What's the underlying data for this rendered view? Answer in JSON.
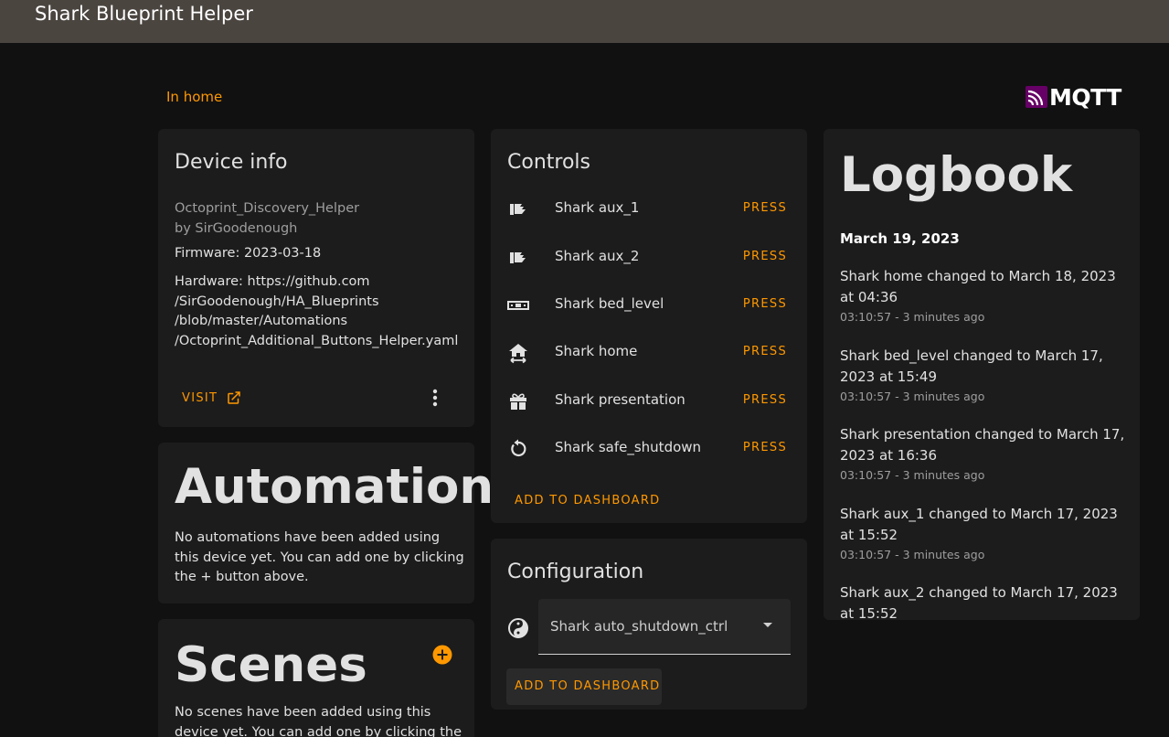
{
  "header": {
    "title": "Shark Blueprint Helper"
  },
  "area_link": "In home",
  "mqtt_logo": {
    "label": "MQTT",
    "icon": "mqtt-logo-icon",
    "brand_color": "#660066"
  },
  "device_info": {
    "title": "Device info",
    "model": "Octoprint_Discovery_Helper",
    "manufacturer": "by SirGoodenough",
    "firmware": "Firmware: 2023-03-18",
    "hardware_lines": [
      "Hardware: https://github.com",
      "/SirGoodenough/HA_Blueprints",
      "/blob/master/Automations",
      "/Octoprint_Additional_Buttons_Helper.yaml"
    ],
    "visit_label": "VISIT",
    "visit_icon": "open-in-new-icon",
    "menu_icon": "dots-vertical-icon"
  },
  "automations": {
    "title": "Automations",
    "description": "No automations have been added using this device yet. You can add one by clicking the + button above."
  },
  "scenes": {
    "title": "Scenes",
    "add_icon": "plus-circle-icon",
    "description": "No scenes have been added using this device yet. You can add one by clicking the + button above."
  },
  "controls": {
    "title": "Controls",
    "items": [
      {
        "name": "Shark aux_1",
        "action": "PRESS",
        "icon": "flag-icon"
      },
      {
        "name": "Shark aux_2",
        "action": "PRESS",
        "icon": "flag-icon"
      },
      {
        "name": "Shark bed_level",
        "action": "PRESS",
        "icon": "level-icon"
      },
      {
        "name": "Shark home",
        "action": "PRESS",
        "icon": "home-arrows-icon"
      },
      {
        "name": "Shark presentation",
        "action": "PRESS",
        "icon": "gift-icon"
      },
      {
        "name": "Shark safe_shutdown",
        "action": "PRESS",
        "icon": "restart-icon"
      }
    ],
    "add_to_dashboard": "ADD TO DASHBOARD"
  },
  "configuration": {
    "title": "Configuration",
    "icon": "yin-yang-icon",
    "select_value": "Shark auto_shutdown_ctrl",
    "add_to_dashboard": "ADD TO DASHBOARD"
  },
  "logbook": {
    "title": "Logbook",
    "date": "March 19, 2023",
    "entries": [
      {
        "message": "Shark home changed to March 18, 2023 at 04:36",
        "time": "03:10:57 - 3 minutes ago"
      },
      {
        "message": "Shark bed_level changed to March 17, 2023 at 15:49",
        "time": "03:10:57 - 3 minutes ago"
      },
      {
        "message": "Shark presentation changed to March 17, 2023 at 16:36",
        "time": "03:10:57 - 3 minutes ago"
      },
      {
        "message": "Shark aux_1 changed to March 17, 2023 at 15:52",
        "time": "03:10:57 - 3 minutes ago"
      },
      {
        "message": "Shark aux_2 changed to March 17, 2023 at 15:52",
        "time": ""
      }
    ]
  },
  "colors": {
    "accent": "#ff9800",
    "header_bg": "#4b4540",
    "card_bg": "#1c1c1c",
    "page_bg": "#111111"
  }
}
